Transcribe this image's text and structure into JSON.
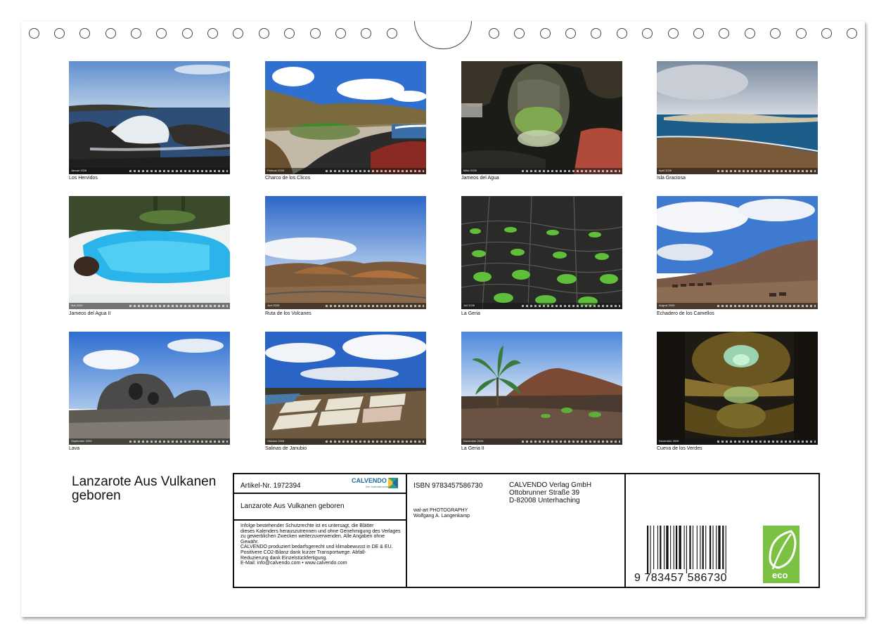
{
  "photos": [
    {
      "caption": "Los Hervidos",
      "month": "Januar 2026"
    },
    {
      "caption": "Charco de los Clicos",
      "month": "Februar 2026"
    },
    {
      "caption": "Jameos del Agua",
      "month": "März 2026"
    },
    {
      "caption": "Isla Graciosa",
      "month": "April 2026"
    },
    {
      "caption": "Jameos del Agua II",
      "month": "Mai 2026"
    },
    {
      "caption": "Ruta de los Volcanes",
      "month": "Juni 2026"
    },
    {
      "caption": "La Geria",
      "month": "Juli 2026"
    },
    {
      "caption": "Echadero de los Camellos",
      "month": "August 2026"
    },
    {
      "caption": "Lava",
      "month": "September 2026"
    },
    {
      "caption": "Salinas de Janubio",
      "month": "Oktober 2026"
    },
    {
      "caption": "La Geria II",
      "month": "November 2026"
    },
    {
      "caption": "Cueva de los Verdes",
      "month": "Dezember 2026"
    }
  ],
  "calendar_title": "Lanzarote Aus Vulkanen geboren",
  "info": {
    "artikel": "Artikel-Nr. 1972394",
    "brand": "CALVENDO",
    "brand_sub": "Der Kalenderverlag",
    "title": "Lanzarote Aus Vulkanen geboren",
    "legal": [
      "Infolge bestehender Schutzrechte ist es untersagt, die Blätter",
      "dieses Kalenders herauszutrennen und ohne Genehmigung des Verlages",
      "zu gewerblichen Zwecken weiterzuverwenden. Alle Angaben ohne",
      "Gewähr.",
      "CALVENDO produziert bedarfsgerecht und klimabewusst in DE & EU.",
      "Positivere CO2-Bilanz dank kurzer Transportwege. Abfall-",
      "Reduzierung dank Einzelstückfertigung.",
      "E-Mail: info@calvendo.com • www.calvendo.com"
    ],
    "isbn": "ISBN 9783457586730",
    "publisher": [
      "CALVENDO Verlag GmbH",
      "Ottobrunner Straße 39",
      "D-82008 Unterhaching"
    ],
    "author": [
      "wal-art PHOTOGRAPHY",
      "Wolfgang A. Langenkamp"
    ],
    "ean": "9 783457 586730",
    "eco_label": "eco"
  }
}
